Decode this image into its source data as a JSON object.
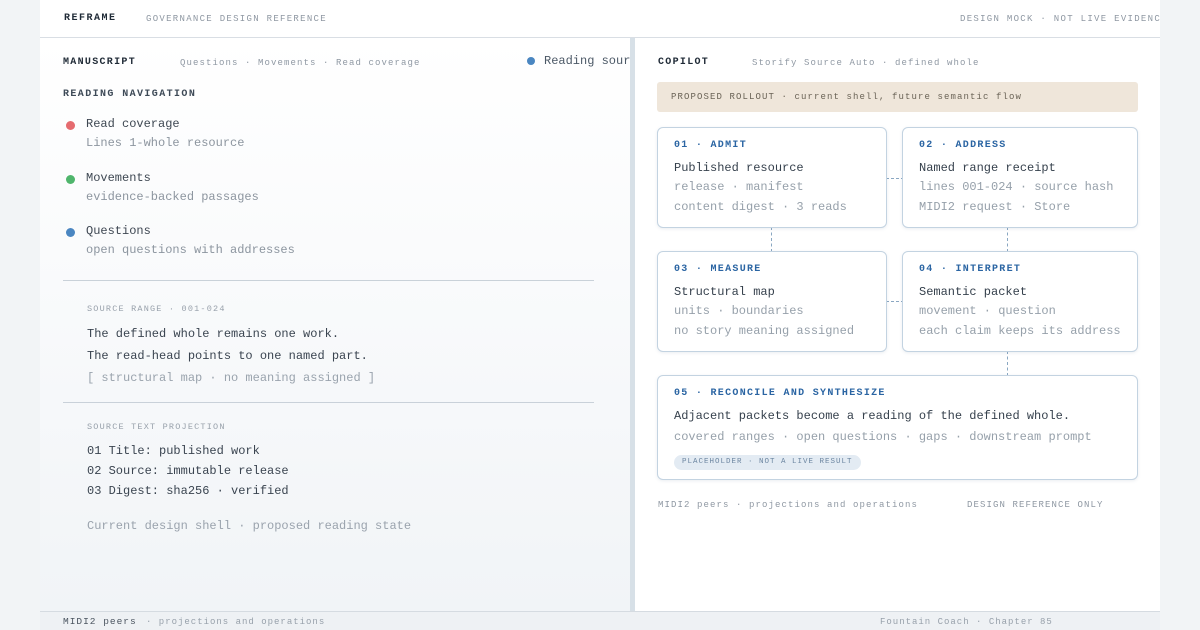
{
  "topbar": {
    "brand": "REFRAME",
    "subtitle": "GOVERNANCE DESIGN REFERENCE",
    "status": "DESIGN MOCK · NOT LIVE EVIDENCE"
  },
  "manuscript": {
    "title": "MANUSCRIPT",
    "tabs": "Questions · Movements · Read coverage",
    "reading_source": "Reading source",
    "reading_source_color": "#4a86c1",
    "nav_heading": "READING NAVIGATION",
    "nav_items": [
      {
        "label": "Read coverage",
        "sub": "Lines 1-whole resource",
        "color": "#e56b6f"
      },
      {
        "label": "Movements",
        "sub": "evidence-backed passages",
        "color": "#4fb56c"
      },
      {
        "label": "Questions",
        "sub": "open questions with addresses",
        "color": "#4a86c1"
      }
    ],
    "source_range": {
      "heading": "SOURCE RANGE · 001-024",
      "line1": "The defined whole remains one work.",
      "line2": "The read-head points to one named part.",
      "line3": "[ structural map · no meaning assigned ]"
    },
    "projection": {
      "heading": "SOURCE TEXT PROJECTION",
      "lines": [
        "01 Title: published work",
        "02 Source: immutable release",
        "03 Digest: sha256 · verified"
      ],
      "footer": "Current design shell · proposed reading state"
    }
  },
  "copilot": {
    "title": "COPILOT",
    "subtitle": "Storify Source Auto · defined whole",
    "rollout": "PROPOSED ROLLOUT · current shell, future semantic flow",
    "cards": [
      {
        "head": "01 · ADMIT",
        "main": "Published resource",
        "sub1": "release · manifest",
        "sub2": "content digest · 3 reads"
      },
      {
        "head": "02 · ADDRESS",
        "main": "Named range receipt",
        "sub1": "lines 001-024 · source hash",
        "sub2": "MIDI2 request · Store"
      },
      {
        "head": "03 · MEASURE",
        "main": "Structural map",
        "sub1": "units · boundaries",
        "sub2": "no story meaning assigned"
      },
      {
        "head": "04 · INTERPRET",
        "main": "Semantic packet",
        "sub1": "movement · question",
        "sub2": "each claim keeps its address"
      },
      {
        "head": "05 · RECONCILE AND SYNTHESIZE",
        "main": "Adjacent packets become a reading of the defined whole.",
        "sub1": "covered ranges · open questions · gaps · downstream prompt",
        "pill": "PLACEHOLDER · NOT A LIVE RESULT"
      }
    ],
    "footer_left": "MIDI2 peers · projections and operations",
    "footer_right": "DESIGN REFERENCE ONLY"
  },
  "bottombar": {
    "left": "MIDI2 peers",
    "left_sub": "· projections and operations",
    "right": "Fountain Coach · Chapter 85"
  }
}
